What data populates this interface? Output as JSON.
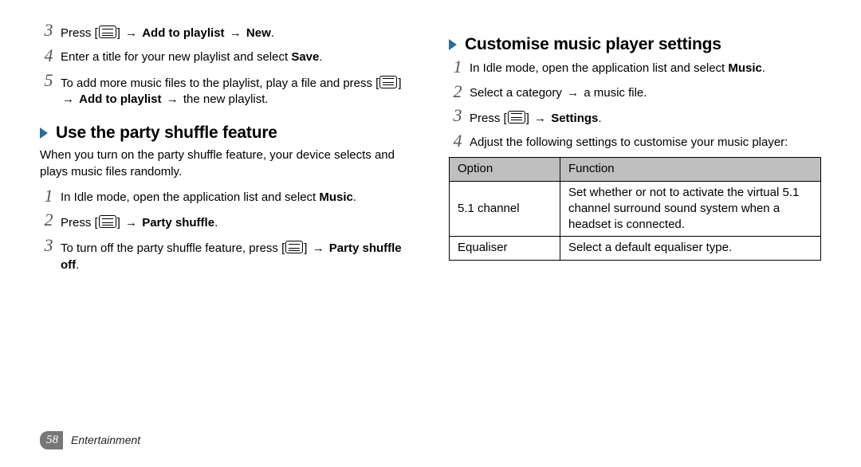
{
  "left": {
    "steps_a": [
      {
        "num": "3",
        "parts": [
          "Press [",
          "##MENU##",
          "] ",
          "##ARROW##",
          " ",
          {
            "b": "Add to playlist"
          },
          " ",
          "##ARROW##",
          " ",
          {
            "b": "New"
          },
          "."
        ]
      },
      {
        "num": "4",
        "parts": [
          "Enter a title for your new playlist and select ",
          {
            "b": "Save"
          },
          "."
        ]
      },
      {
        "num": "5",
        "parts": [
          "To add more music files to the playlist, play a file and press [",
          "##MENU##",
          "] ",
          "##ARROW##",
          " ",
          {
            "b": "Add to playlist"
          },
          " ",
          "##ARROW##",
          " the new playlist."
        ]
      }
    ],
    "section_b": {
      "title": "Use the party shuffle feature",
      "desc": "When you turn on the party shuffle feature, your device selects and plays music files randomly.",
      "steps": [
        {
          "num": "1",
          "parts": [
            "In Idle mode, open the application list and select ",
            {
              "b": "Music"
            },
            "."
          ]
        },
        {
          "num": "2",
          "parts": [
            "Press [",
            "##MENU##",
            "] ",
            "##ARROW##",
            " ",
            {
              "b": "Party shuffle"
            },
            "."
          ]
        },
        {
          "num": "3",
          "parts": [
            "To turn off the party shuffle feature, press [",
            "##MENU##",
            "] ",
            "##ARROW##",
            " ",
            {
              "b": "Party shuffle off"
            },
            "."
          ]
        }
      ]
    }
  },
  "right": {
    "section": {
      "title": "Customise music player settings",
      "steps": [
        {
          "num": "1",
          "parts": [
            "In Idle mode, open the application list and select ",
            {
              "b": "Music"
            },
            "."
          ]
        },
        {
          "num": "2",
          "parts": [
            "Select a category ",
            "##ARROW##",
            " a music file."
          ]
        },
        {
          "num": "3",
          "parts": [
            "Press [",
            "##MENU##",
            "] ",
            "##ARROW##",
            " ",
            {
              "b": "Settings"
            },
            "."
          ]
        },
        {
          "num": "4",
          "parts": [
            "Adjust the following settings to customise your music player:"
          ]
        }
      ],
      "table": {
        "headers": [
          "Option",
          "Function"
        ],
        "rows": [
          [
            "5.1 channel",
            "Set whether or not to activate the virtual 5.1 channel surround sound system when a headset is connected."
          ],
          [
            "Equaliser",
            "Select a default equaliser type."
          ]
        ]
      }
    }
  },
  "footer": {
    "page": "58",
    "chapter": "Entertainment"
  }
}
